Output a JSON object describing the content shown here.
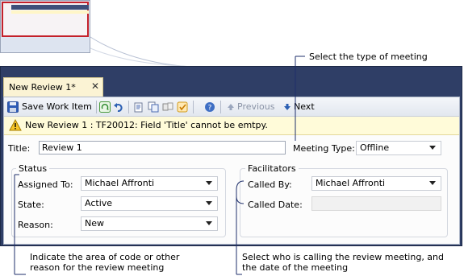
{
  "callouts": {
    "top": "Select the type of meeting",
    "bottom_left_line1": "Indicate the area of code or other",
    "bottom_left_line2": "reason for the review meeting",
    "bottom_right_line1": "Select who is calling the review meeting, and",
    "bottom_right_line2": "the date of the meeting"
  },
  "tab": {
    "title": "New Review 1*",
    "close": "✕"
  },
  "toolbar": {
    "save_label": "Save Work Item",
    "previous_label": "Previous",
    "next_label": "Next"
  },
  "warning": {
    "text": "New Review 1 : TF20012: Field 'Title' cannot be emtpy."
  },
  "form": {
    "title_label": "Title:",
    "title_value": "Review 1",
    "meeting_type_label": "Meeting Type:",
    "meeting_type_value": "Offline",
    "status": {
      "legend": "Status",
      "assigned_to_label": "Assigned To:",
      "assigned_to_value": "Michael Affronti",
      "state_label": "State:",
      "state_value": "Active",
      "reason_label": "Reason:",
      "reason_value": "New"
    },
    "facilitators": {
      "legend": "Facilitators",
      "called_by_label": "Called By:",
      "called_by_value": "Michael Affronti",
      "called_date_label": "Called Date:",
      "called_date_value": ""
    }
  },
  "colors": {
    "window_frame": "#2f3e66",
    "tab_active": "#fbf3d4",
    "warning_bg": "#fffbd9",
    "callout_line": "#1f2f6b",
    "thumbnail_highlight": "#c4202a"
  }
}
